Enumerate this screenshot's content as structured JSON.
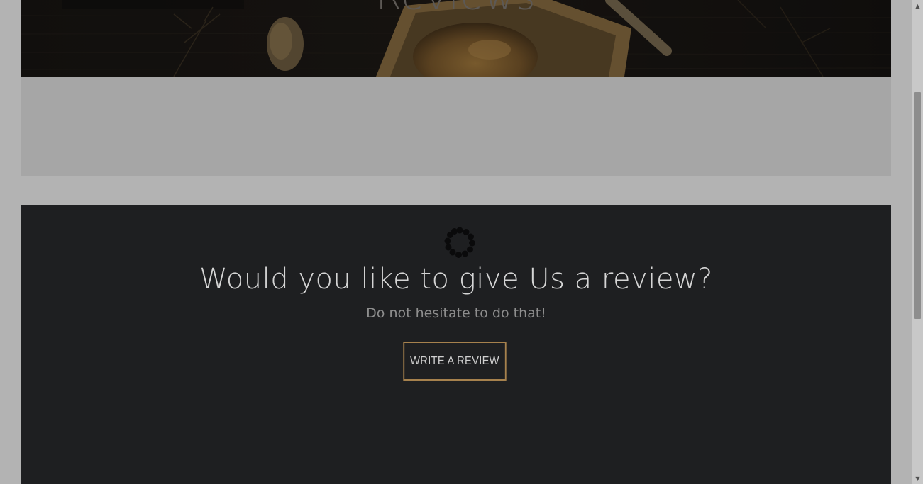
{
  "hero": {
    "title": "Reviews"
  },
  "cta": {
    "heading": "Would you like to give Us a review?",
    "subheading": "Do not hesitate to do that!",
    "button_label": "Write a review"
  },
  "colors": {
    "page_background": "#b3b3b3",
    "section_background": "#1e1f21",
    "button_border": "#a6814d"
  },
  "icons": {
    "loader": "spinner-icon",
    "scroll_up": "arrow-up-icon",
    "scroll_down": "arrow-down-icon"
  }
}
